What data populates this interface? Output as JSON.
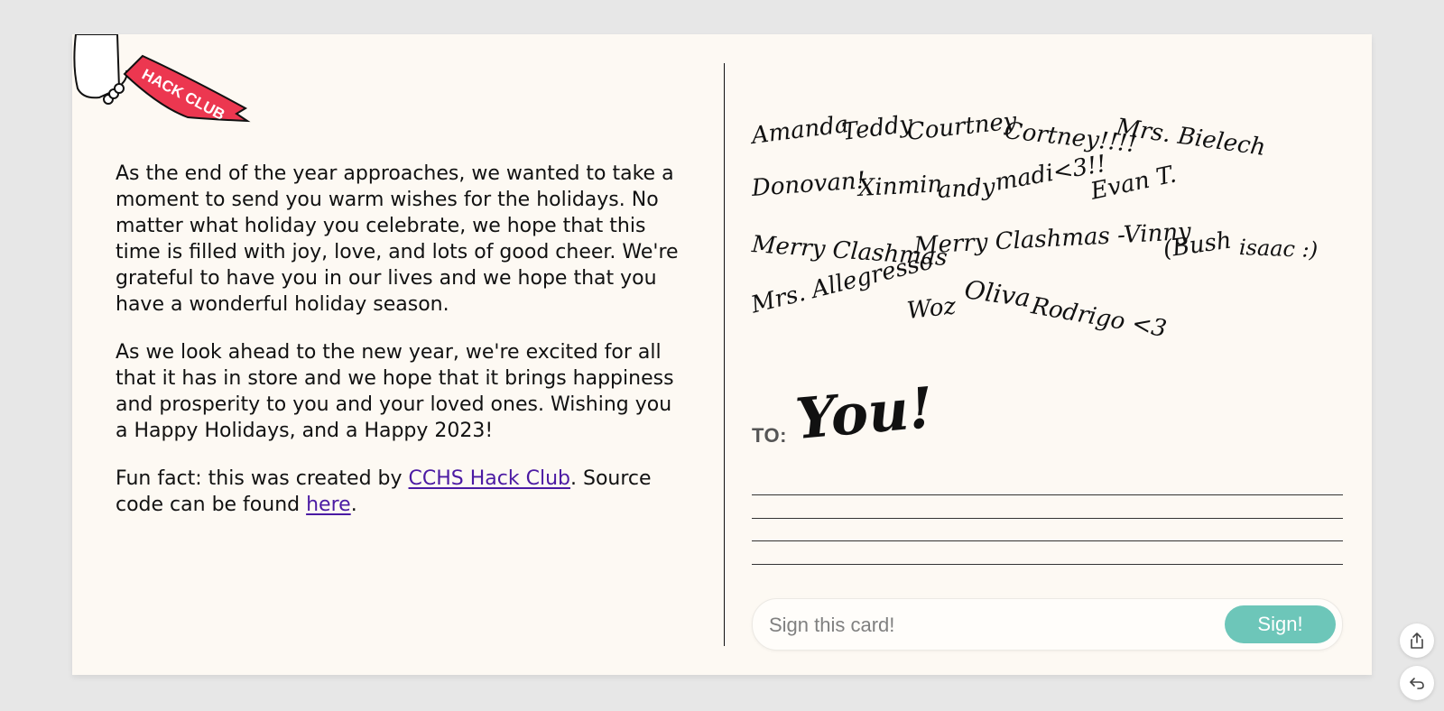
{
  "logo": {
    "text": "HACK CLUB"
  },
  "message": {
    "paragraph1": "As the end of the year approaches, we wanted to take a moment to send you warm wishes for the holidays. No matter what holiday you celebrate, we hope that this time is filled with joy, love, and lots of good cheer. We're grateful to have you in our lives and we hope that you have a wonderful holiday season.",
    "paragraph2": "As we look ahead to the new year, we're excited for all that it has in store and we hope that it brings happiness and prosperity to you and your loved ones. Wishing you a Happy Holidays, and a Happy 2023!",
    "funfact_prefix": "Fun fact: this was created by ",
    "funfact_link": "CCHS Hack Club",
    "funfact_middle": ". Source code can be found ",
    "funfact_link2": "here",
    "funfact_suffix": "."
  },
  "signatures": [
    "Amanda",
    "Teddy",
    "Courtney",
    "Cortney!!!!",
    "Mrs. Bielech",
    "Donovan!",
    "Xinmin",
    "andy",
    "madi<3!!",
    "Evan T.",
    "Merry Clashmas",
    "Merry Clashmas -Vinny",
    "(Bush",
    "isaac :)",
    "Mrs. Allegresso",
    "Woz",
    "Oliva",
    "Rodrigo <3"
  ],
  "recipient": {
    "label": "TO:",
    "name": "You!"
  },
  "sign_form": {
    "placeholder": "Sign this card!",
    "button_label": "Sign!"
  },
  "colors": {
    "card_background": "#fdf9f3",
    "button": "#6dc6b9",
    "link": "#4b1aa3",
    "banner": "#ec3750"
  },
  "icons": {
    "share": "share-icon",
    "back": "return-icon"
  }
}
